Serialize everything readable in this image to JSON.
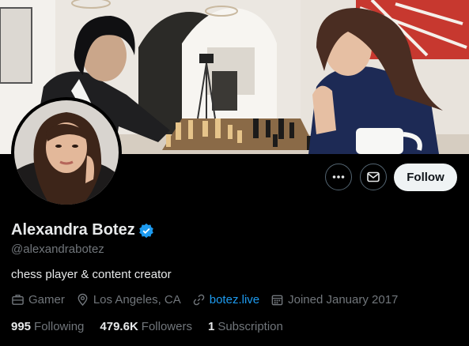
{
  "profile": {
    "display_name": "Alexandra Botez",
    "handle": "@alexandrabotez",
    "bio": "chess player & content creator",
    "verified": true
  },
  "actions": {
    "more_icon": "more-horizontal-icon",
    "message_icon": "mail-icon",
    "follow_label": "Follow"
  },
  "meta": {
    "category": "Gamer",
    "location": "Los Angeles, CA",
    "website": "botez.live",
    "joined": "Joined January 2017"
  },
  "stats": {
    "following_count": "995",
    "following_label": "Following",
    "followers_count": "479.6K",
    "followers_label": "Followers",
    "subscriptions_count": "1",
    "subscriptions_label": "Subscription"
  },
  "colors": {
    "background": "#000000",
    "accent": "#1d9bf0",
    "muted": "#71767b",
    "text": "#e7e9ea"
  }
}
